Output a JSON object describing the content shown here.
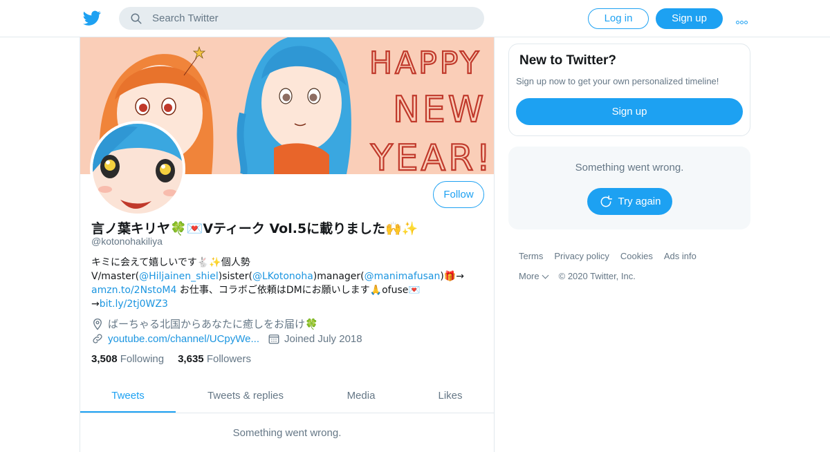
{
  "header": {
    "search_placeholder": "Search Twitter",
    "login_label": "Log in",
    "signup_label": "Sign up"
  },
  "banner": {
    "text_lines": [
      "HAPPY",
      "NEW",
      "YEAR!"
    ]
  },
  "profile": {
    "name": "言ノ葉キリヤ🍀💌Vティーク Vol.5に載りました🙌✨",
    "handle": "@kotonohakiliya",
    "follow_label": "Follow",
    "bio": {
      "line1": "キミに会えて嬉しいです🐇✨個人勢",
      "line2_a": "V/master(",
      "mention1": "@Hiljainen_shiel",
      "line2_b": ")sister(",
      "mention2": "@LKotonoha",
      "line2_c": ")manager(",
      "mention3": "@manimafusan",
      "line2_d": ")🎁→",
      "link1": "amzn.to/2NstoM4",
      "line3": " お仕事、コラボご依頼はDMにお願いします🙏ofuse💌",
      "line4_prefix": "→",
      "link2": "bit.ly/2tj0WZ3"
    },
    "location": "ばーちゃる北国からあなたに癒しをお届け🍀",
    "url": "youtube.com/channel/UCpyWe...",
    "joined": "Joined July 2018",
    "following_count": "3,508",
    "following_label": "Following",
    "followers_count": "3,635",
    "followers_label": "Followers"
  },
  "tabs": [
    {
      "label": "Tweets",
      "active": true
    },
    {
      "label": "Tweets & replies"
    },
    {
      "label": "Media"
    },
    {
      "label": "Likes"
    }
  ],
  "timeline": {
    "error": "Something went wrong."
  },
  "sidebar": {
    "new_title": "New to Twitter?",
    "new_desc": "Sign up now to get your own personalized timeline!",
    "signup_label": "Sign up",
    "error_msg": "Something went wrong.",
    "retry_label": "Try again"
  },
  "footer": {
    "terms": "Terms",
    "privacy": "Privacy policy",
    "cookies": "Cookies",
    "ads": "Ads info",
    "more": "More",
    "copyright": "© 2020 Twitter, Inc."
  },
  "colors": {
    "accent": "#1da1f2",
    "secondary_text": "#657786",
    "banner_bg": "#f7c6ae",
    "banner_text": "#c0392b"
  }
}
